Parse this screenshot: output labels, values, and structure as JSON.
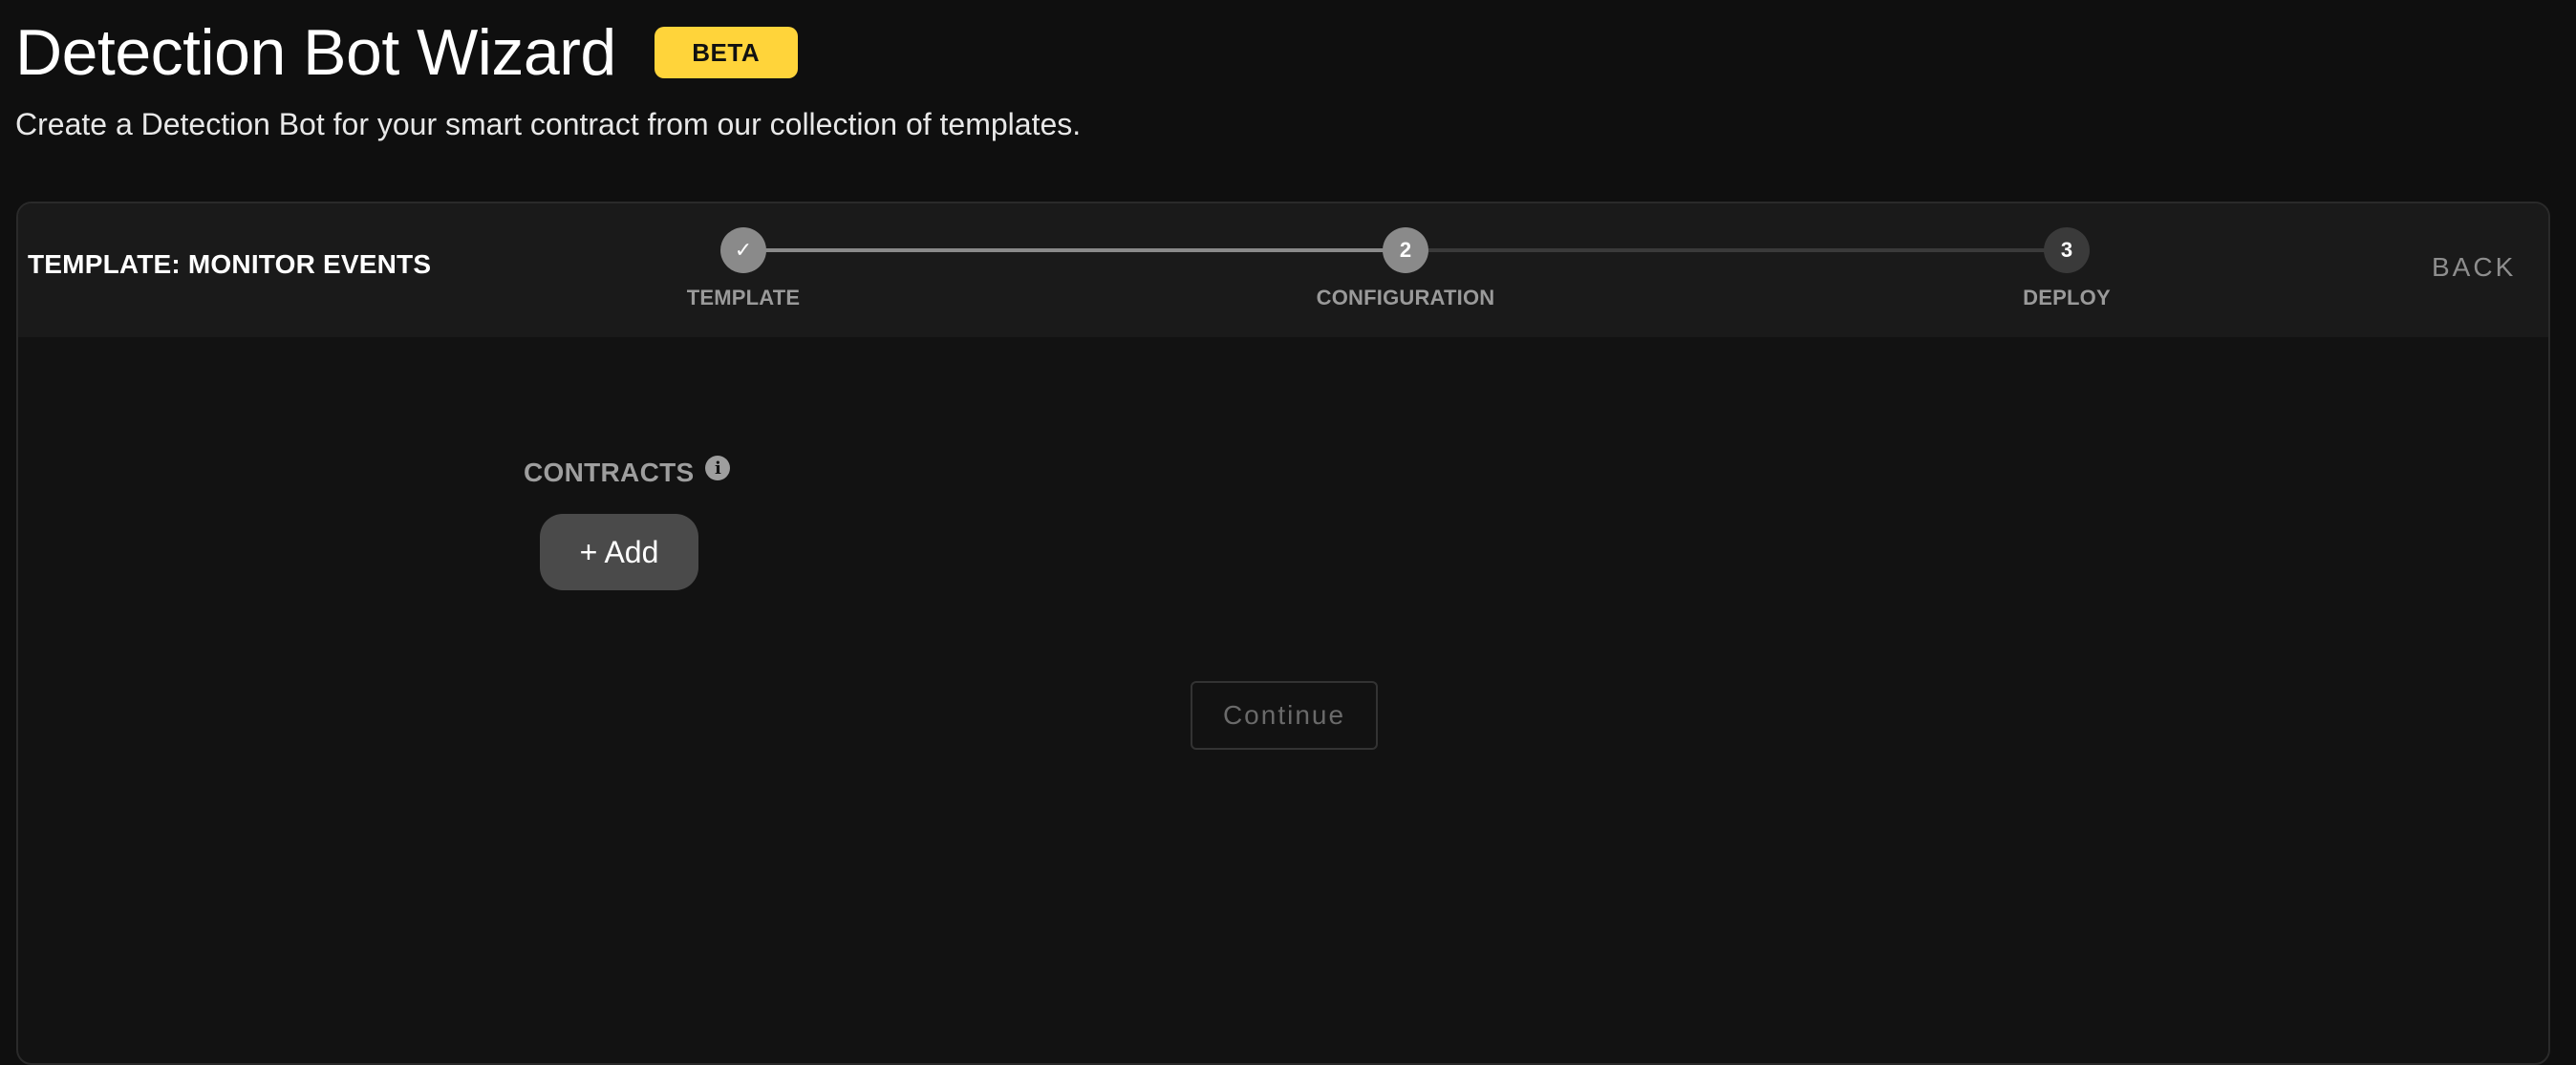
{
  "header": {
    "title": "Detection Bot Wizard",
    "badge": "BETA",
    "subtitle": "Create a Detection Bot for your smart contract from our collection of templates."
  },
  "wizard": {
    "template_name": "TEMPLATE: MONITOR EVENTS",
    "back_label": "BACK",
    "steps": [
      {
        "label": "TEMPLATE",
        "marker": "✓",
        "status": "completed"
      },
      {
        "label": "CONFIGURATION",
        "marker": "2",
        "status": "active"
      },
      {
        "label": "DEPLOY",
        "marker": "3",
        "status": "pending"
      }
    ],
    "contracts_label": "CONTRACTS",
    "info_icon": "info-icon",
    "add_label": "+ Add",
    "continue_label": "Continue"
  },
  "colors": {
    "background": "#0f0f0f",
    "badge": "#ffd43a",
    "step_done": "#8a8a8a",
    "step_pending": "#3a3a3a"
  }
}
